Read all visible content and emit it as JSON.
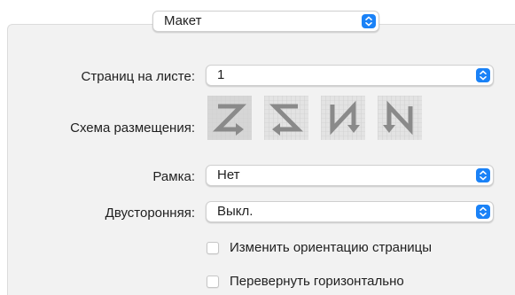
{
  "top_menu": {
    "value": "Макет"
  },
  "pages_per_sheet": {
    "label": "Страниц на листе:",
    "value": "1"
  },
  "layout_direction": {
    "label": "Схема размещения:",
    "options": [
      {
        "icon": "z-layout-icon",
        "selected": true
      },
      {
        "icon": "reverse-z-layout-icon",
        "selected": false
      },
      {
        "icon": "reverse-n-layout-icon",
        "selected": false
      },
      {
        "icon": "n-layout-icon",
        "selected": false
      }
    ]
  },
  "border": {
    "label": "Рамка:",
    "value": "Нет"
  },
  "two_sided": {
    "label": "Двусторонняя:",
    "value": "Выкл."
  },
  "reverse_orientation": {
    "label": "Изменить ориентацию страницы",
    "checked": false
  },
  "flip_horizontal": {
    "label": "Перевернуть горизонтально",
    "checked": false
  },
  "colors": {
    "accent": "#1a82f7",
    "panel": "#f2f2f2",
    "icon_glyph": "#8a8a8a"
  }
}
